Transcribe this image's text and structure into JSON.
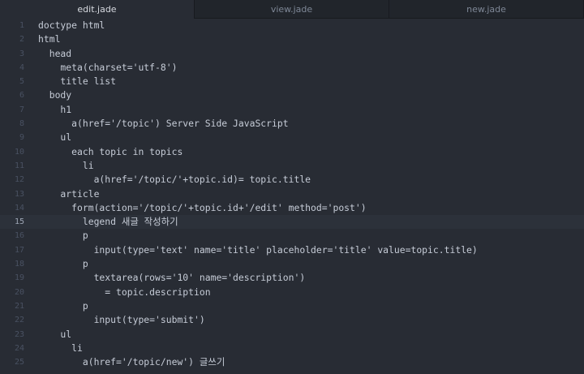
{
  "tabs": [
    {
      "label": "edit.jade",
      "active": true
    },
    {
      "label": "view.jade",
      "active": false
    },
    {
      "label": "new.jade",
      "active": false
    }
  ],
  "current_line": 15,
  "lines": [
    "doctype html",
    "html",
    "  head",
    "    meta(charset='utf-8')",
    "    title list",
    "  body",
    "    h1",
    "      a(href='/topic') Server Side JavaScript",
    "    ul",
    "      each topic in topics",
    "        li",
    "          a(href='/topic/'+topic.id)= topic.title",
    "    article",
    "      form(action='/topic/'+topic.id+'/edit' method='post')",
    "        legend 새글 작성하기",
    "        p",
    "          input(type='text' name='title' placeholder='title' value=topic.title)",
    "        p",
    "          textarea(rows='10' name='description')",
    "            = topic.description",
    "        p",
    "          input(type='submit')",
    "    ul",
    "      li",
    "        a(href='/topic/new') 글쓰기"
  ],
  "line_numbers": [
    "1",
    "2",
    "3",
    "4",
    "5",
    "6",
    "7",
    "8",
    "9",
    "10",
    "11",
    "12",
    "13",
    "14",
    "15",
    "16",
    "17",
    "18",
    "19",
    "20",
    "21",
    "22",
    "23",
    "24",
    "25"
  ],
  "colors": {
    "background": "#282c34",
    "tabbar": "#21252b",
    "text": "#c6ccd7",
    "gutter": "#495162",
    "current_line": "#2c313a"
  }
}
